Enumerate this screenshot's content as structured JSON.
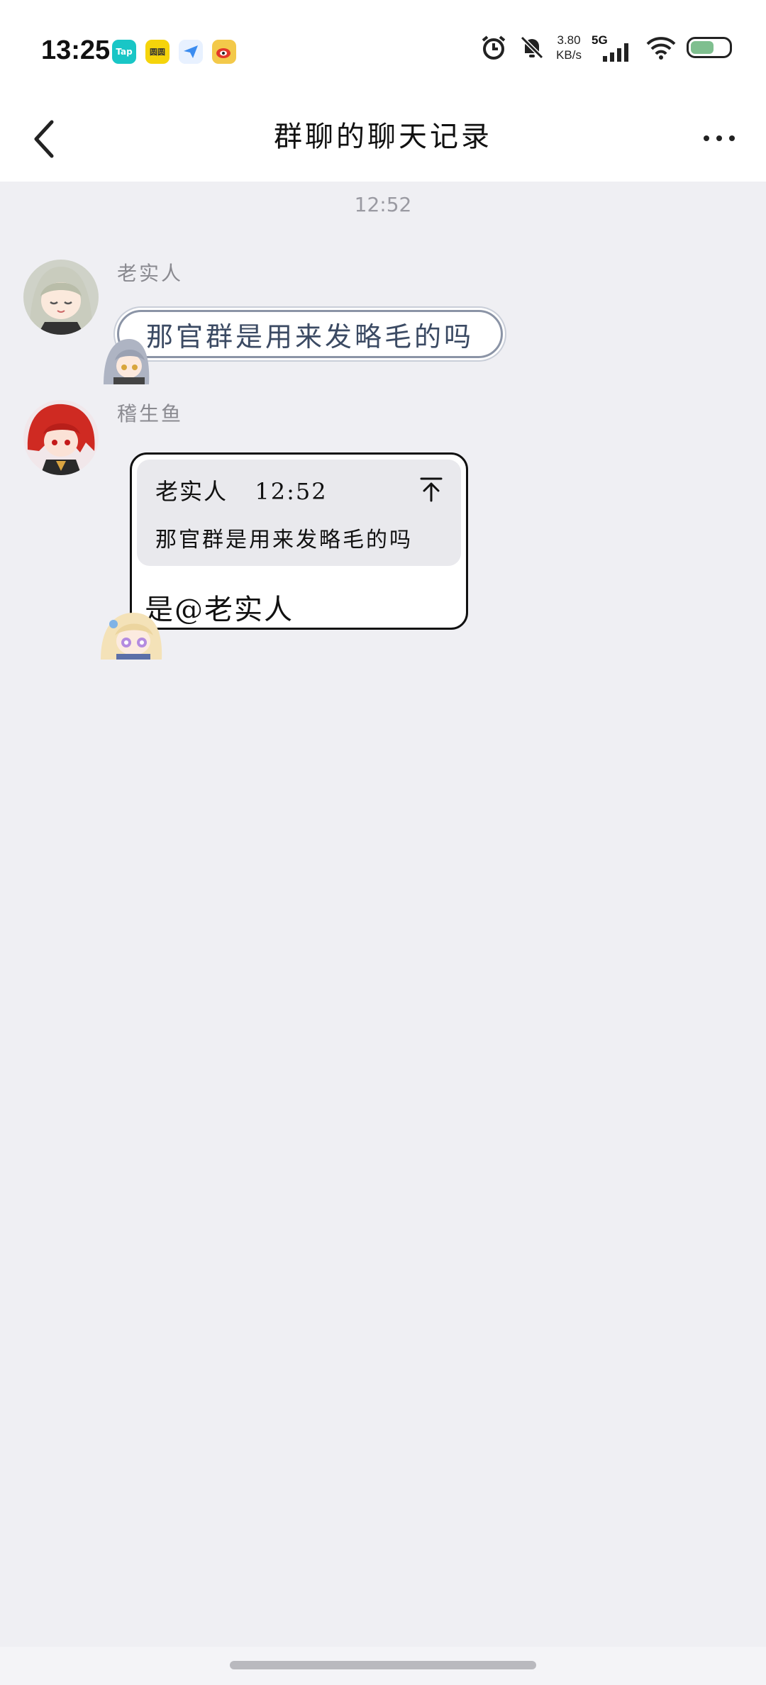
{
  "status_bar": {
    "time": "13:25",
    "app_icons": [
      {
        "name": "taptap-icon",
        "label": "Tap",
        "color": "#19c6c6"
      },
      {
        "name": "yellow-app-icon",
        "label": "圆圆",
        "color": "#f5d40b"
      },
      {
        "name": "send-app-icon",
        "label": "",
        "color": "#3b8cf0"
      },
      {
        "name": "weibo-icon",
        "label": "",
        "color": "#f3c94a"
      }
    ],
    "net_speed_value": "3.80",
    "net_speed_unit": "KB/s",
    "network_type": "5G"
  },
  "header": {
    "title": "群聊的聊天记录"
  },
  "chat": {
    "timestamp": "12:52",
    "messages": [
      {
        "sender": "老实人",
        "text": "那官群是用来发略毛的吗"
      },
      {
        "sender": "稽生鱼",
        "quote_sender": "老实人",
        "quote_time": "12:52",
        "quote_text": "那官群是用来发略毛的吗",
        "reply_prefix": "是",
        "reply_mention": "@老实人"
      }
    ]
  },
  "colors": {
    "background": "#efeff3",
    "header_bg": "#ffffff",
    "bubble1_border": "#8b94a6",
    "bubble1_text": "#3b4a63",
    "quote_bg": "#e9e9ed"
  }
}
